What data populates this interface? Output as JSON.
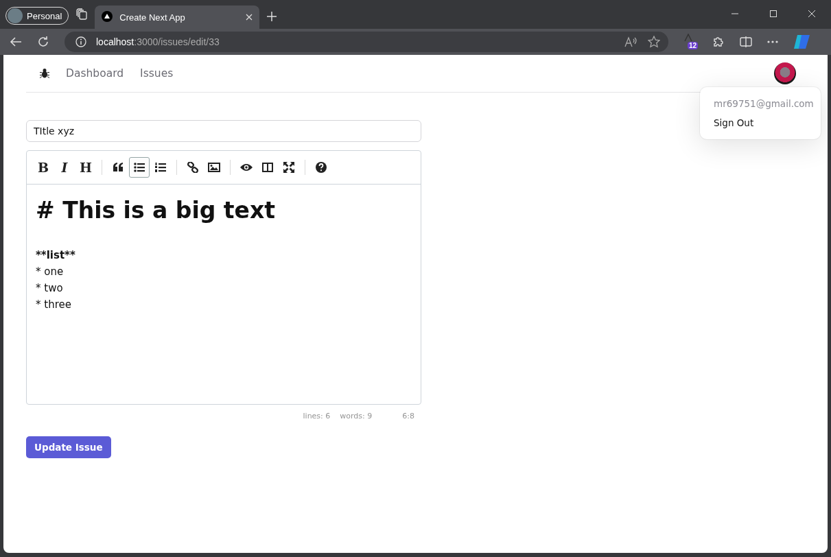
{
  "browser": {
    "profile": "Personal",
    "tabs": [
      {
        "title": "Create Next App",
        "selected": true
      }
    ],
    "url_host": "localhost",
    "url_path": ":3000/issues/edit/33",
    "extension_badge": "12"
  },
  "nav": {
    "links": [
      {
        "label": "Dashboard"
      },
      {
        "label": "Issues"
      }
    ]
  },
  "user_menu": {
    "email": "mr69751@gmail.com",
    "items": [
      "Sign Out"
    ]
  },
  "form": {
    "title_value": "TItle xyz",
    "toolbar": [
      {
        "kind": "bold",
        "glyph": "B",
        "active": false
      },
      {
        "kind": "italic",
        "glyph": "I",
        "active": false
      },
      {
        "kind": "heading",
        "glyph": "H",
        "active": false
      },
      {
        "kind": "separator"
      },
      {
        "kind": "quote",
        "active": false
      },
      {
        "kind": "unordered-list",
        "active": true
      },
      {
        "kind": "ordered-list",
        "active": false
      },
      {
        "kind": "separator"
      },
      {
        "kind": "link",
        "active": false
      },
      {
        "kind": "image",
        "active": false
      },
      {
        "kind": "separator"
      },
      {
        "kind": "preview",
        "active": false
      },
      {
        "kind": "side-by-side",
        "active": false
      },
      {
        "kind": "fullscreen",
        "active": false
      },
      {
        "kind": "separator"
      },
      {
        "kind": "guide",
        "active": false
      }
    ],
    "lines": [
      {
        "kind": "heading",
        "text": "# This is a big text"
      },
      {
        "kind": "blank"
      },
      {
        "kind": "bold",
        "text": "**list**"
      },
      {
        "kind": "plain",
        "text": "* one"
      },
      {
        "kind": "plain",
        "text": "* two"
      },
      {
        "kind": "plain",
        "text": "* three"
      }
    ],
    "status": {
      "lines": "lines: 6",
      "words": "words: 9",
      "cursor": "6:8"
    },
    "submit": "Update Issue"
  }
}
